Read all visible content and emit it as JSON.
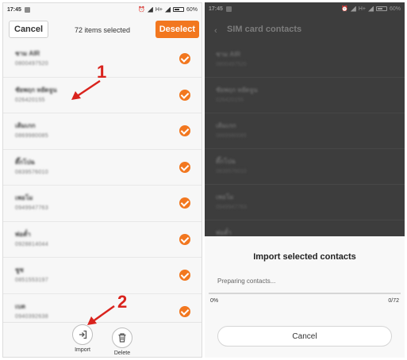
{
  "left": {
    "status": {
      "time": "17:45",
      "network": "H+",
      "battery": "60%"
    },
    "topbar": {
      "cancel_label": "Cancel",
      "selected_text": "72 items selected",
      "deselect_label": "Deselect"
    },
    "contacts": [
      {
        "name": "ชาม AIR",
        "phone": "0800497520"
      },
      {
        "name": "ชัยพฤก หยัดจูน",
        "phone": "026420155"
      },
      {
        "name": "เติมเกก",
        "phone": "0869980085"
      },
      {
        "name": "ตึ๊กโปฉ",
        "phone": "0839576010"
      },
      {
        "name": "เพอโม",
        "phone": "0949947763"
      },
      {
        "name": "พ่อตั๋า",
        "phone": "0928814044"
      },
      {
        "name": "ชูช",
        "phone": "0851553197"
      },
      {
        "name": "เบต",
        "phone": "0940392638"
      }
    ],
    "actions": {
      "import_label": "Import",
      "delete_label": "Delete"
    },
    "annotations": {
      "one": "1",
      "two": "2"
    }
  },
  "right": {
    "status": {
      "time": "17:45",
      "network": "H+",
      "battery": "60%"
    },
    "title": "SIM card contacts",
    "contacts": [
      {
        "name": "ชาม AIR",
        "phone": "0800497520"
      },
      {
        "name": "ชัยพฤก หยัดจูน",
        "phone": "026420155"
      },
      {
        "name": "เติมเกก",
        "phone": "0869980085"
      },
      {
        "name": "ตึ๊กโปฉ",
        "phone": "0839576010"
      },
      {
        "name": "เพอโม",
        "phone": "0949947763"
      },
      {
        "name": "พ่อตั๋า",
        "phone": ""
      }
    ],
    "dialog": {
      "title": "Import selected contacts",
      "status": "Preparing contacts...",
      "progress_fraction": 0,
      "progress_percent": "0%",
      "progress_count": "0/72",
      "cancel_label": "Cancel"
    }
  },
  "colors": {
    "accent": "#f2771f",
    "annotation": "#d9231d",
    "overlay": "#3d3d3d"
  }
}
